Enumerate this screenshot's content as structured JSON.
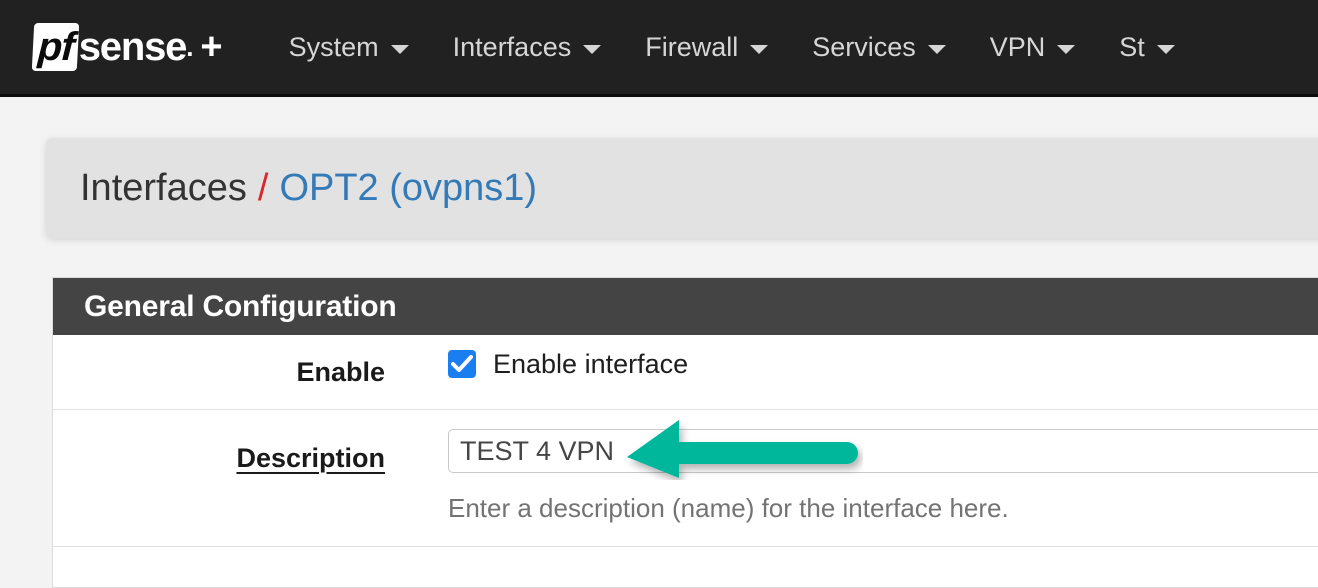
{
  "navbar": {
    "brand": {
      "mark": "pf",
      "name": "sense",
      "dot": ".",
      "plus": "+"
    },
    "menu_items": [
      {
        "label": "System",
        "icon": "chevron-down-icon"
      },
      {
        "label": "Interfaces",
        "icon": "chevron-down-icon"
      },
      {
        "label": "Firewall",
        "icon": "chevron-down-icon"
      },
      {
        "label": "Services",
        "icon": "chevron-down-icon"
      },
      {
        "label": "VPN",
        "icon": "chevron-down-icon"
      },
      {
        "label": "St",
        "icon": "chevron-down-icon"
      }
    ],
    "background_color": "#212121",
    "text_color": "#d6d6d6"
  },
  "breadcrumb": {
    "parent": "Interfaces",
    "separator": "/",
    "separator_color": "#d9272d",
    "current": "OPT2 (ovpns1)",
    "current_color": "#337ab7"
  },
  "panel": {
    "title": "General Configuration",
    "header_color": "#444444",
    "rows": {
      "enable": {
        "label": "Enable",
        "checkbox_label": "Enable interface",
        "checked": true,
        "checkbox_color": "#1a7ef0"
      },
      "description": {
        "label": "Description",
        "value": "TEST 4 VPN",
        "placeholder": "",
        "help": "Enter a description (name) for the interface here."
      }
    }
  },
  "annotation": {
    "arrow": {
      "icon": "left-arrow-annotation",
      "color": "#01b79b",
      "direction": "left"
    }
  }
}
